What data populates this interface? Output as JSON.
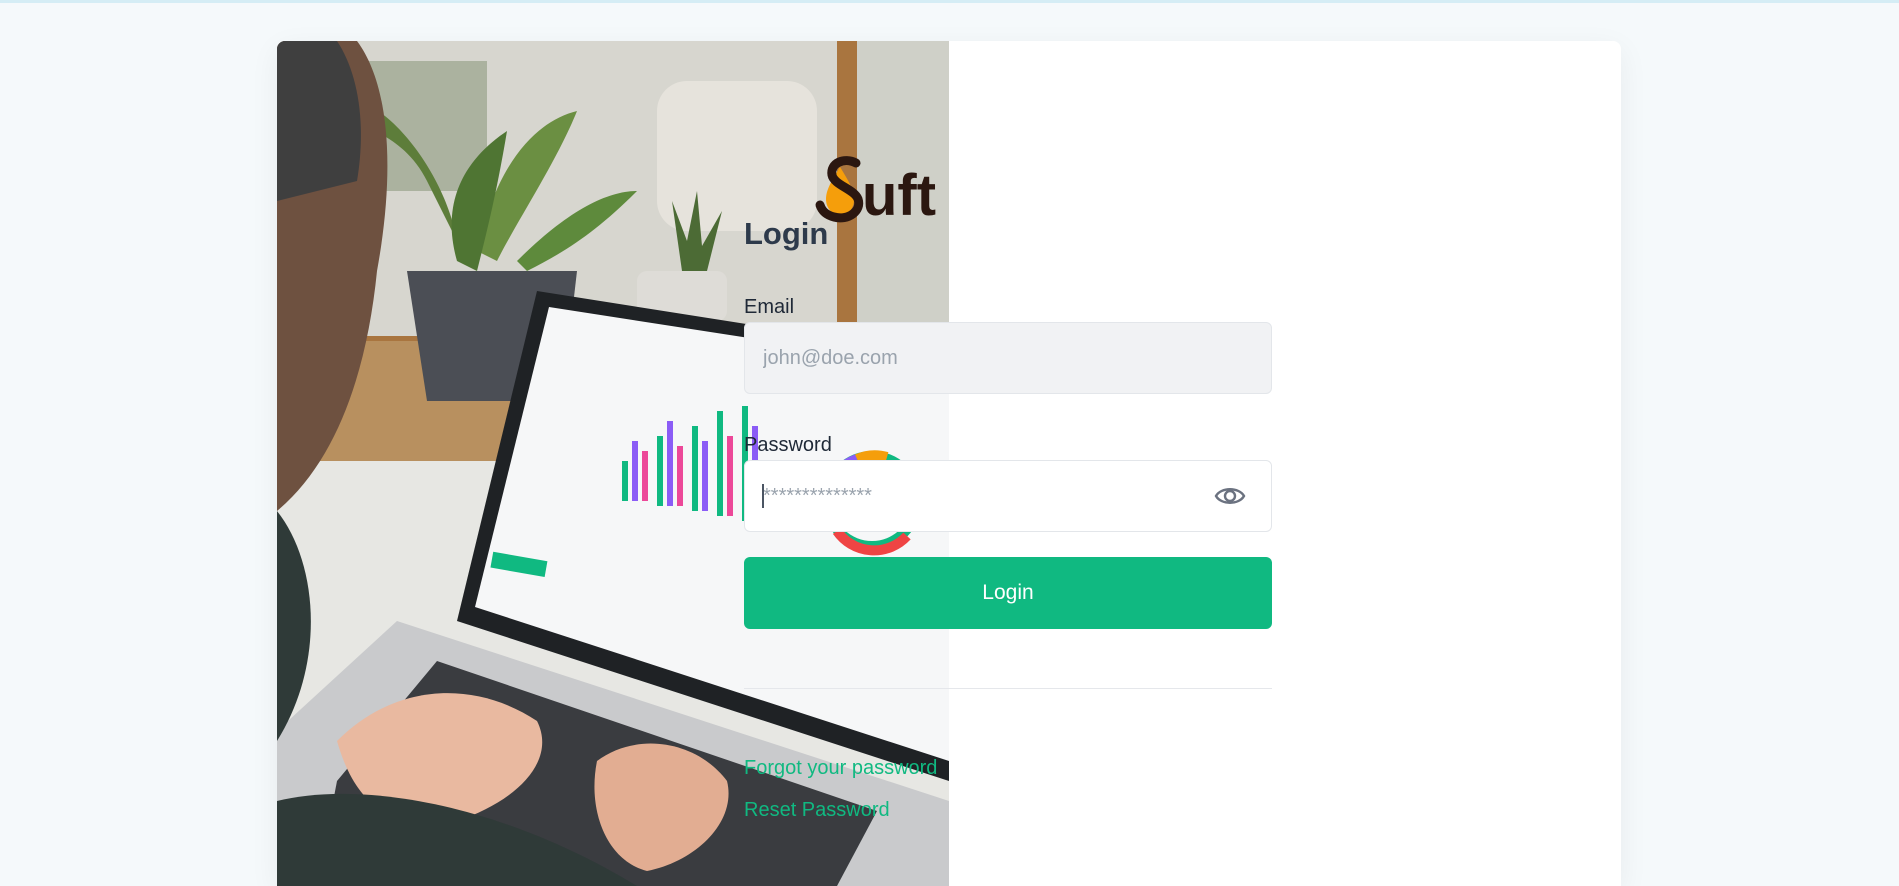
{
  "brand": {
    "logo_text": "Suft",
    "accent_color": "#10b981",
    "logo_drop_color": "#f59e0b"
  },
  "hero": {
    "image_icon": "person-laptop-photo"
  },
  "form": {
    "title": "Login",
    "email": {
      "label": "Email",
      "placeholder": "john@doe.com",
      "value": ""
    },
    "password": {
      "label": "Password",
      "placeholder": "**************",
      "value": "",
      "toggle_icon": "eye-icon"
    },
    "submit_label": "Login"
  },
  "links": {
    "forgot_password": "Forgot your password",
    "reset_password": "Reset Password"
  }
}
